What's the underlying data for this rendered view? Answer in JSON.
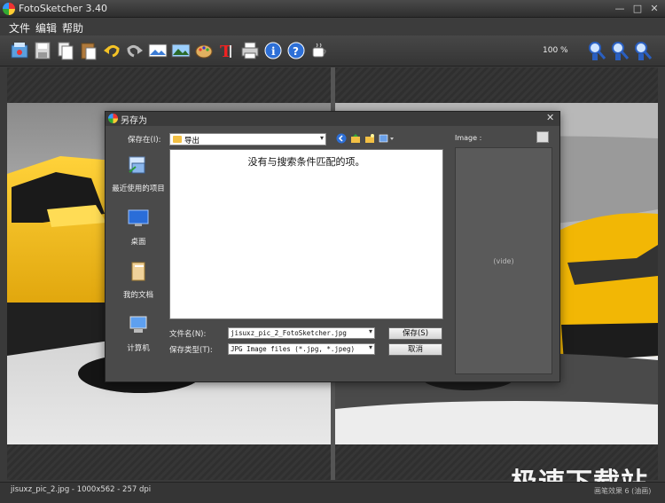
{
  "window": {
    "title": "FotoSketcher 3.40"
  },
  "menu": [
    "文件",
    "编辑",
    "帮助"
  ],
  "toolbar": {
    "zoom": "100 %",
    "tools": [
      "open-icon",
      "save-icon",
      "copy-icon",
      "paste-icon",
      "undo-icon",
      "redo-icon",
      "image-icon",
      "picture-icon",
      "palette-icon",
      "text-icon",
      "print-icon",
      "info-icon",
      "help-icon",
      "coffee-icon",
      "zoom-in-icon",
      "zoom-out-icon",
      "zoom-fit-icon"
    ]
  },
  "status": {
    "text": "jisuxz_pic_2.jpg - 1000x562 - 257 dpi",
    "right": "画笔效果 6 (油画)"
  },
  "watermark": "极速下载站",
  "dialog": {
    "title": "另存为",
    "save_in_label": "保存在(I):",
    "save_in_value": "导出",
    "places": [
      {
        "label": "最近使用的项目",
        "icon": "recent-items-icon"
      },
      {
        "label": "桌面",
        "icon": "desktop-icon"
      },
      {
        "label": "我的文档",
        "icon": "documents-icon"
      },
      {
        "label": "计算机",
        "icon": "computer-icon"
      }
    ],
    "empty_message": "没有与搜索条件匹配的项。",
    "filename_label": "文件名(N):",
    "filename_value": "jisuxz_pic_2_FotoSketcher.jpg",
    "filetype_label": "保存类型(T):",
    "filetype_value": "JPG Image files (*.jpg, *.jpeg)",
    "save_button": "保存(S)",
    "cancel_button": "取消",
    "image_label": "Image :",
    "preview_empty": "(vide)"
  }
}
